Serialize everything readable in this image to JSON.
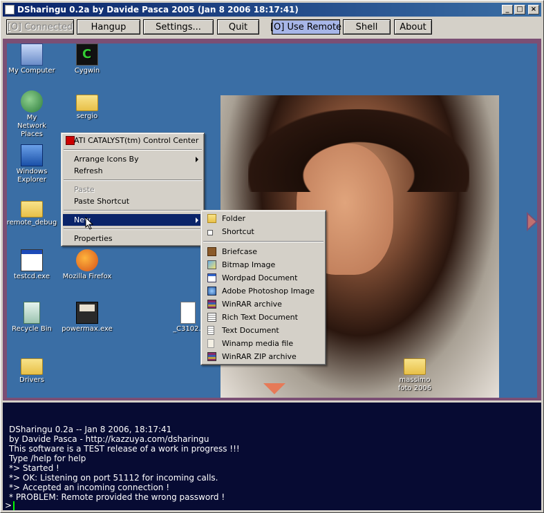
{
  "window": {
    "title": "DSharingu 0.2a by Davide Pasca 2005 (Jan  8 2006 18:17:41)",
    "min_glyph": "_",
    "max_glyph": "□",
    "close_glyph": "×"
  },
  "toolbar": {
    "connected": "[O] Connected",
    "hangup": "Hangup",
    "settings": "Settings...",
    "quit": "Quit",
    "use_remote": "[O] Use Remote",
    "shell": "Shell",
    "about": "About"
  },
  "desktop": {
    "icons": [
      {
        "label": "My Computer",
        "icon": "computer-icon"
      },
      {
        "label": "Cygwin",
        "icon": "cygwin-icon"
      },
      {
        "label": "My Network Places",
        "icon": "network-places-icon"
      },
      {
        "label": "sergio",
        "icon": "folder-icon"
      },
      {
        "label": "Windows Explorer",
        "icon": "windows-explorer-icon"
      },
      {
        "label": "remote_debug",
        "icon": "folder-icon"
      },
      {
        "label": "testcd.exe",
        "icon": "exe-icon"
      },
      {
        "label": "Mozilla Firefox",
        "icon": "firefox-icon"
      },
      {
        "label": "Recycle Bin",
        "icon": "recycle-bin-icon"
      },
      {
        "label": "powermax.exe",
        "icon": "floppy-icon"
      },
      {
        "label": "_C3102..",
        "icon": "document-icon"
      },
      {
        "label": "Drivers",
        "icon": "folder-icon"
      },
      {
        "label": "massimo foto 2006",
        "icon": "folder-icon"
      }
    ]
  },
  "context_menu": {
    "ati": "ATI CATALYST(tm) Control Center",
    "arrange": "Arrange Icons By",
    "refresh": "Refresh",
    "paste": "Paste",
    "paste_shortcut": "Paste Shortcut",
    "new": "New",
    "properties": "Properties"
  },
  "new_submenu": [
    {
      "label": "Folder",
      "icon": "folder-icon"
    },
    {
      "label": "Shortcut",
      "icon": "shortcut-icon"
    },
    {
      "label": "Briefcase",
      "icon": "briefcase-icon"
    },
    {
      "label": "Bitmap Image",
      "icon": "bitmap-icon"
    },
    {
      "label": "Wordpad Document",
      "icon": "wordpad-icon"
    },
    {
      "label": "Adobe Photoshop Image",
      "icon": "photoshop-icon"
    },
    {
      "label": "WinRAR archive",
      "icon": "winrar-icon"
    },
    {
      "label": "Rich Text Document",
      "icon": "rich-text-icon"
    },
    {
      "label": "Text Document",
      "icon": "text-document-icon"
    },
    {
      "label": "Winamp media file",
      "icon": "winamp-icon"
    },
    {
      "label": "WinRAR ZIP archive",
      "icon": "winrar-zip-icon"
    }
  ],
  "console": {
    "lines": [
      "DSharingu 0.2a -- Jan  8 2006, 18:17:41",
      "by Davide Pasca - http://kazzuya.com/dsharingu",
      "This software is a TEST release of a work in progress !!!",
      "Type /help for help",
      "*> Started !",
      "*> OK: Listening on port 51112 for incoming calls.",
      "*> Accepted an incoming connection !",
      "* PROBLEM: Remote provided the wrong password !"
    ],
    "prompt": ">"
  }
}
